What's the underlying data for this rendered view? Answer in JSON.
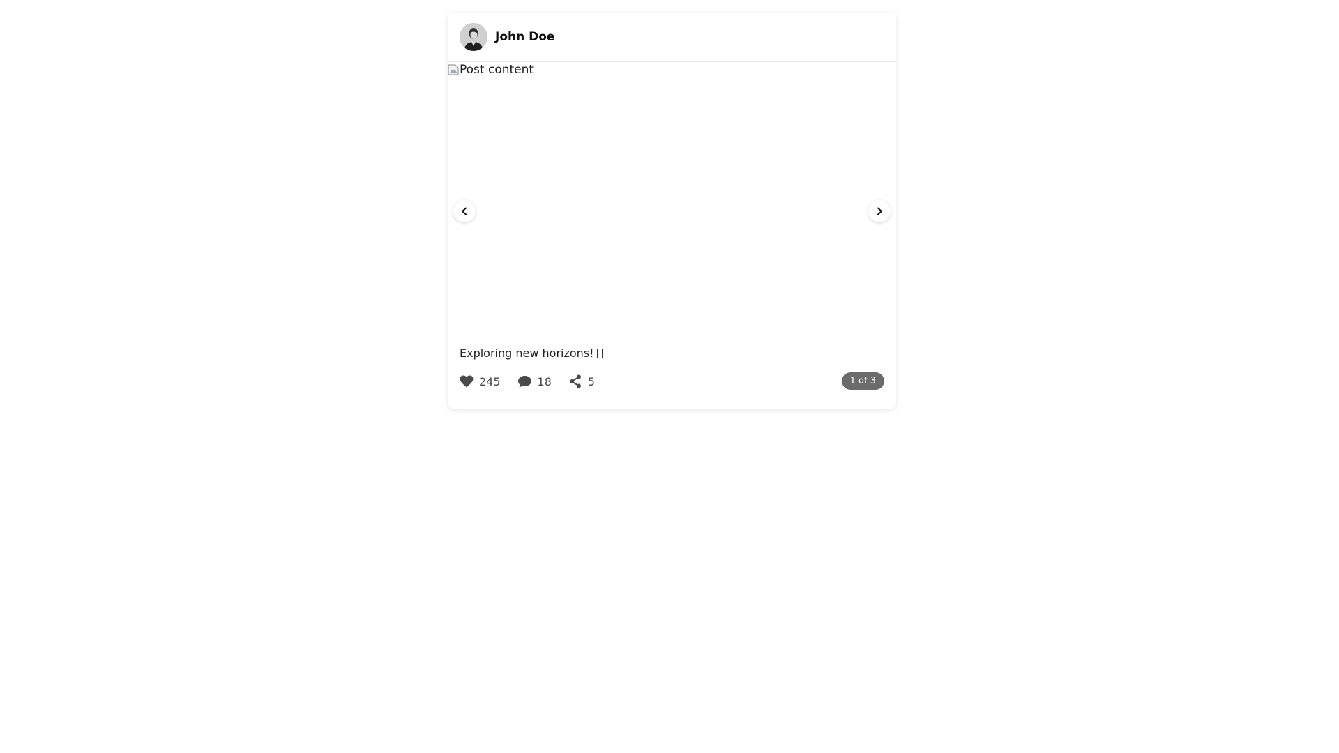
{
  "post": {
    "author": {
      "name": "John Doe"
    },
    "media": {
      "alt_text": "Post content",
      "prev_icon": "chevron-left-icon",
      "next_icon": "chevron-right-icon"
    },
    "caption": "Exploring new horizons!",
    "stats": {
      "likes": "245",
      "comments": "18",
      "shares": "5"
    },
    "carousel_counter": "1 of 3"
  },
  "colors": {
    "icon": "#4a4a4a",
    "counter_bg": "#6b6b6b"
  }
}
